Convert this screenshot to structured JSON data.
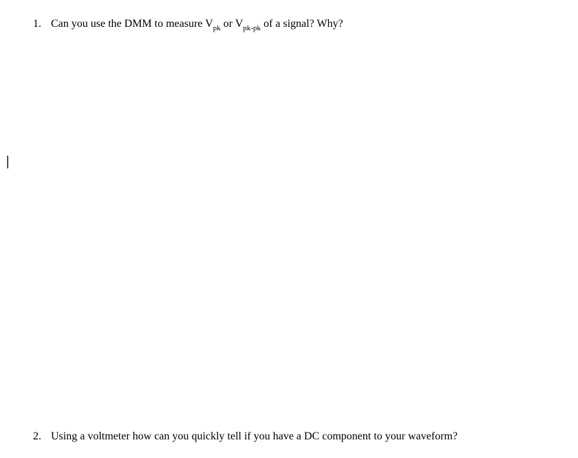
{
  "questions": [
    {
      "number": "1.",
      "prefix": "Can you use the DMM to measure V",
      "sub1": "pk",
      "mid": " or V",
      "sub2": "pk-pk",
      "suffix": " of a signal? Why?"
    },
    {
      "number": "2.",
      "text": "Using a voltmeter how can you quickly tell if you have a DC component to your waveform?"
    }
  ],
  "cursor": "|"
}
